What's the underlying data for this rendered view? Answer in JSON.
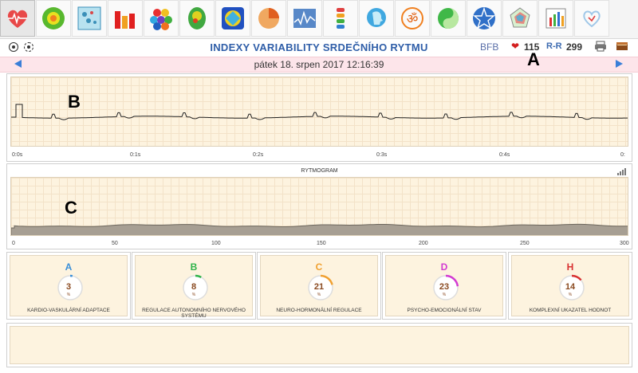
{
  "toolbar": {
    "icons": [
      "heart-ecg-icon",
      "green-sphere-icon",
      "grid-dots-icon",
      "bar-chart-icon",
      "hexagon-grid-icon",
      "brain-map-icon",
      "target-diamond-icon",
      "pie-chart-icon",
      "waveform-icon",
      "spine-icon",
      "head-profile-icon",
      "om-symbol-icon",
      "yin-yang-icon",
      "pentagram-icon",
      "radar-icon",
      "small-bar-chart-icon",
      "heart-ribbon-icon"
    ]
  },
  "header": {
    "title": "INDEXY VARIABILITY SRDEČNÍHO RYTMU",
    "bfb": "BFB",
    "heart_rate": "115",
    "rr_label": "R-R",
    "rr_value": "299"
  },
  "datebar": {
    "date": "pátek 18. srpen 2017 12:16:39"
  },
  "annotations": {
    "a": "A",
    "b": "B",
    "c": "C"
  },
  "ecg": {
    "ticks": [
      "0:0s",
      "0:1s",
      "0:2s",
      "0:3s",
      "0:4s",
      "0:"
    ]
  },
  "rytmogram": {
    "title": "RYTMOGRAM",
    "ticks": [
      "0",
      "50",
      "100",
      "150",
      "200",
      "250",
      "300"
    ]
  },
  "indices": [
    {
      "letter": "A",
      "value": "3",
      "pct": "%",
      "label": "KARDIO-VASKULÁRNÍ ADAPTACE",
      "color": "#3a8fd8",
      "fraction": 0.03
    },
    {
      "letter": "B",
      "value": "8",
      "pct": "%",
      "label": "REGULACE AUTONOMNÍHO NERVOVÉHO SYSTÉMU",
      "color": "#2fb34a",
      "fraction": 0.08
    },
    {
      "letter": "C",
      "value": "21",
      "pct": "%",
      "label": "NEURO-HORMONÁLNÍ REGULACE",
      "color": "#f0a030",
      "fraction": 0.21
    },
    {
      "letter": "D",
      "value": "23",
      "pct": "%",
      "label": "PSYCHO-EMOCIONÁLNÍ STAV",
      "color": "#d23ad2",
      "fraction": 0.23
    },
    {
      "letter": "H",
      "value": "14",
      "pct": "%",
      "label": "KOMPLEXNÍ UKAZATEL HODNOT",
      "color": "#d83030",
      "fraction": 0.14
    }
  ]
}
